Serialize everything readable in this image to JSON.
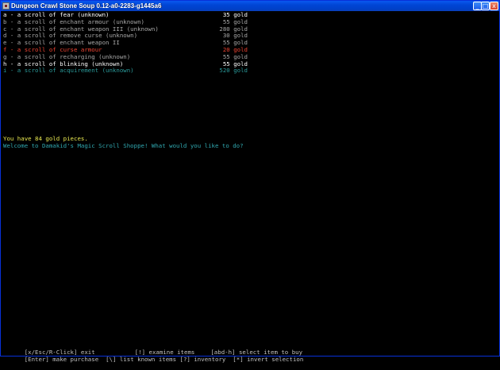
{
  "window": {
    "title": "Dungeon Crawl Stone Soup 0.12-a0-2283-g1445a6",
    "minimize_label": "_",
    "maximize_label": "□",
    "close_label": "x"
  },
  "shop": {
    "items": [
      {
        "description": "a - a scroll of fear (unknown)",
        "price": "35 gold",
        "color": "white"
      },
      {
        "description": "b - a scroll of enchant armour (unknown)",
        "price": "55 gold",
        "color": "grey"
      },
      {
        "description": "c - a scroll of enchant weapon III (unknown)",
        "price": "280 gold",
        "color": "grey"
      },
      {
        "description": "d - a scroll of remove curse (unknown)",
        "price": "30 gold",
        "color": "grey"
      },
      {
        "description": "e - a scroll of enchant weapon II",
        "price": "55 gold",
        "color": "grey"
      },
      {
        "description": "f - a scroll of curse armour",
        "price": "20 gold",
        "color": "red"
      },
      {
        "description": "g - a scroll of recharging (unknown)",
        "price": "55 gold",
        "color": "grey"
      },
      {
        "description": "h - a scroll of blinking (unknown)",
        "price": "55 gold",
        "color": "white"
      },
      {
        "description": "i - a scroll of acquirement (unknown)",
        "price": "520 gold",
        "color": "cyan"
      }
    ],
    "gold_message": "You have 84 gold pieces.",
    "welcome_message": "Welcome to Damakid's Magic Scroll Shoppe! What would you like to do?"
  },
  "help": {
    "line1": [
      {
        "key": "[x/Esc/R-Click]",
        "label": " exit"
      },
      {
        "key": "[!]",
        "label": " examine items"
      },
      {
        "key": "[abd-h]",
        "label": " select item to buy"
      }
    ],
    "line2": [
      {
        "key": "[Enter]",
        "label": " make purchase"
      },
      {
        "key": "[\\]",
        "label": " list known items"
      },
      {
        "key": "[?]",
        "label": " inventory"
      },
      {
        "key": "[*]",
        "label": " invert selection"
      }
    ]
  },
  "colors": {
    "white": "#ffffff",
    "grey": "#a8a8a8",
    "red": "#ee4433",
    "cyan": "#2a9a9a",
    "titlebar": "#0046d5"
  }
}
